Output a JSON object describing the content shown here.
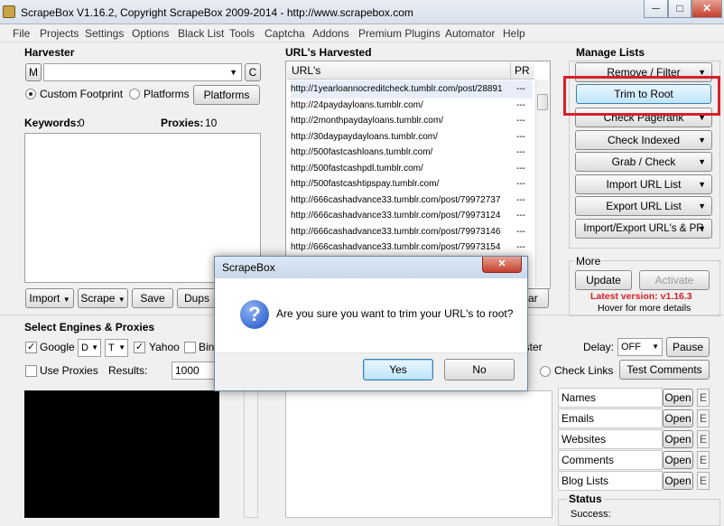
{
  "window": {
    "title": "ScrapeBox V1.16.2, Copyright ScrapeBox 2009-2014 - http://www.scrapebox.com",
    "minimize": "─",
    "maximize": "□",
    "close": "✕"
  },
  "menu": [
    "File",
    "Projects",
    "Settings",
    "Options",
    "Black List",
    "Tools",
    "Captcha",
    "Addons",
    "Premium Plugins",
    "Automator",
    "Help"
  ],
  "harvester": {
    "title": "Harvester",
    "m_button": "M",
    "c_button": "C",
    "custom_footprint": "Custom Footprint",
    "platforms_radio": "Platforms",
    "platforms_button": "Platforms",
    "keywords_label": "Keywords:",
    "keywords_value": "0",
    "proxies_label": "Proxies:",
    "proxies_value": "10",
    "import_button": "Import",
    "scrape_button": "Scrape",
    "save_button": "Save",
    "dups_button": "Dups"
  },
  "urls": {
    "title": "URL's Harvested",
    "col_url": "URL's",
    "col_pr": "PR",
    "rows": [
      {
        "url": "http://1yearloannocreditcheck.tumblr.com/post/28891",
        "pr": "---"
      },
      {
        "url": "http://24paydayloans.tumblr.com/",
        "pr": "---"
      },
      {
        "url": "http://2monthpaydayloans.tumblr.com/",
        "pr": "---"
      },
      {
        "url": "http://30daypaydayloans.tumblr.com/",
        "pr": "---"
      },
      {
        "url": "http://500fastcashloans.tumblr.com/",
        "pr": "---"
      },
      {
        "url": "http://500fastcashpdl.tumblr.com/",
        "pr": "---"
      },
      {
        "url": "http://500fastcashtipspay.tumblr.com/",
        "pr": "---"
      },
      {
        "url": "http://666cashadvance33.tumblr.com/post/79972737",
        "pr": "---"
      },
      {
        "url": "http://666cashadvance33.tumblr.com/post/79973124",
        "pr": "---"
      },
      {
        "url": "http://666cashadvance33.tumblr.com/post/79973146",
        "pr": "---"
      },
      {
        "url": "http://666cashadvance33.tumblr.com/post/79973154",
        "pr": "---"
      }
    ],
    "clear_button": "ear"
  },
  "manage": {
    "title": "Manage Lists",
    "buttons": [
      "Remove / Filter",
      "Trim to Root",
      "Check Pagerank",
      "Check Indexed",
      "Grab / Check",
      "Import URL List",
      "Export URL List",
      "Import/Export URL's & PR"
    ]
  },
  "more": {
    "title": "More",
    "update_button": "Update",
    "activate_button": "Activate",
    "latest_version": "Latest version: v1.16.3",
    "hover_text": "Hover for more details"
  },
  "engines": {
    "title": "Select Engines & Proxies",
    "google": "Google",
    "google_sel1": "D",
    "google_sel2": "T",
    "yahoo": "Yahoo",
    "bing": "Bin",
    "use_proxies": "Use Proxies",
    "results_label": "Results:",
    "results_value": "1000"
  },
  "right_controls": {
    "ister": "ister",
    "delay_label": "Delay:",
    "delay_value": "OFF",
    "pause_button": "Pause",
    "check_links": "Check Links",
    "test_comments": "Test Comments"
  },
  "files": [
    {
      "name": "Names",
      "open": "Open",
      "e": "E"
    },
    {
      "name": "Emails",
      "open": "Open",
      "e": "E"
    },
    {
      "name": "Websites",
      "open": "Open",
      "e": "E"
    },
    {
      "name": "Comments",
      "open": "Open",
      "e": "E"
    },
    {
      "name": "Blog Lists",
      "open": "Open",
      "e": "E"
    }
  ],
  "status": {
    "title": "Status",
    "success_label": "Success:"
  },
  "dialog": {
    "title": "ScrapeBox",
    "message": "Are you sure you want to trim your URL's to root?",
    "yes": "Yes",
    "no": "No",
    "close": "✕"
  },
  "colors": {
    "highlight_box": "#d8202a",
    "latest_version": "#d8202a",
    "dialog_close": "#c4402d"
  }
}
